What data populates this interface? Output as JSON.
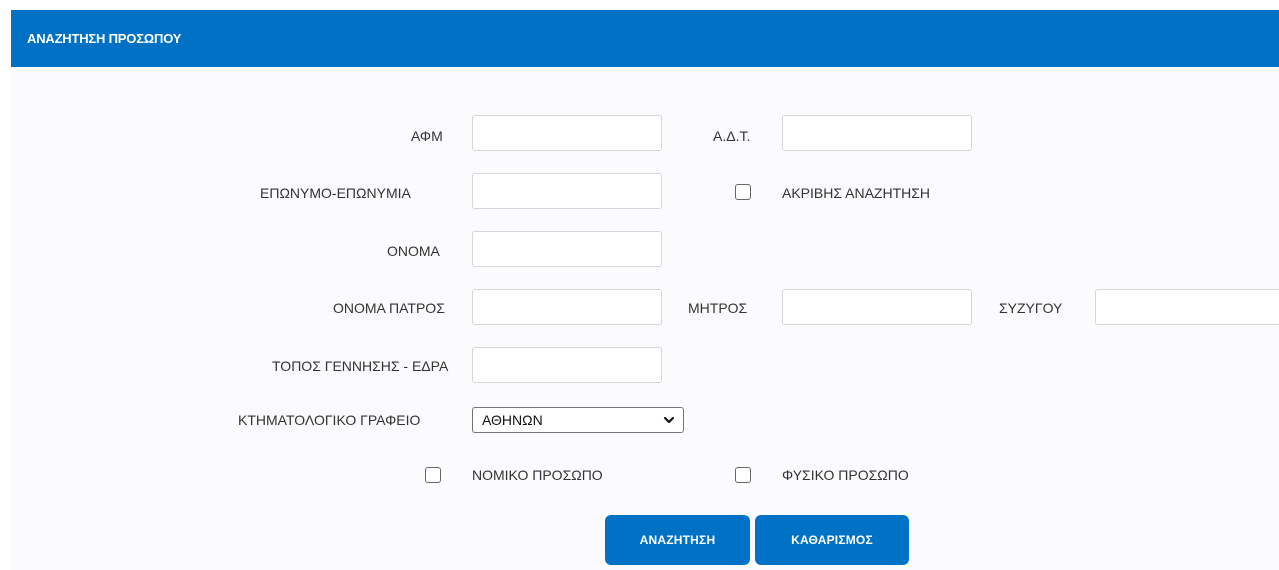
{
  "header": {
    "title": "ΑΝΑΖΗΤΗΣΗ ΠΡΟΣΩΠΟΥ"
  },
  "form": {
    "afm": {
      "label": "ΑΦΜ",
      "value": ""
    },
    "adt": {
      "label": "Α.Δ.Τ.",
      "value": ""
    },
    "surname": {
      "label": "ΕΠΩΝΥΜΟ-ΕΠΩΝΥΜΙΑ",
      "value": ""
    },
    "exact_search": {
      "label": "ΑΚΡΙΒΗΣ ΑΝΑΖΗΤΗΣΗ",
      "checked": false
    },
    "name": {
      "label": "ΟΝΟΜΑ",
      "value": ""
    },
    "father_name": {
      "label": "ΟΝΟΜΑ ΠΑΤΡΟΣ",
      "value": ""
    },
    "mother_name": {
      "label": "ΜΗΤΡΟΣ",
      "value": ""
    },
    "spouse_name": {
      "label": "ΣΥΖΥΓΟΥ",
      "value": ""
    },
    "birthplace": {
      "label": "ΤΟΠΟΣ ΓΕΝΝΗΣΗΣ - ΕΔΡΑ",
      "value": ""
    },
    "cadastral_office": {
      "label": "ΚΤΗΜΑΤΟΛΟΓΙΚΟ ΓΡΑΦΕΙΟ",
      "selected": "ΑΘΗΝΩΝ"
    },
    "legal_entity": {
      "label": "ΝΟΜΙΚΟ ΠΡΟΣΩΠΟ",
      "checked": false
    },
    "natural_person": {
      "label": "ΦΥΣΙΚΟ ΠΡΟΣΩΠΟ",
      "checked": false
    }
  },
  "actions": {
    "search_label": "ΑΝΑΖΗΤΗΣΗ",
    "clear_label": "ΚΑΘΑΡΙΣΜΟΣ"
  },
  "colors": {
    "header_bg": "#0071c5",
    "button_bg": "#0072c6",
    "panel_bg": "#fbfafd"
  },
  "icons": {
    "select_arrow": "chevron-down-icon"
  }
}
